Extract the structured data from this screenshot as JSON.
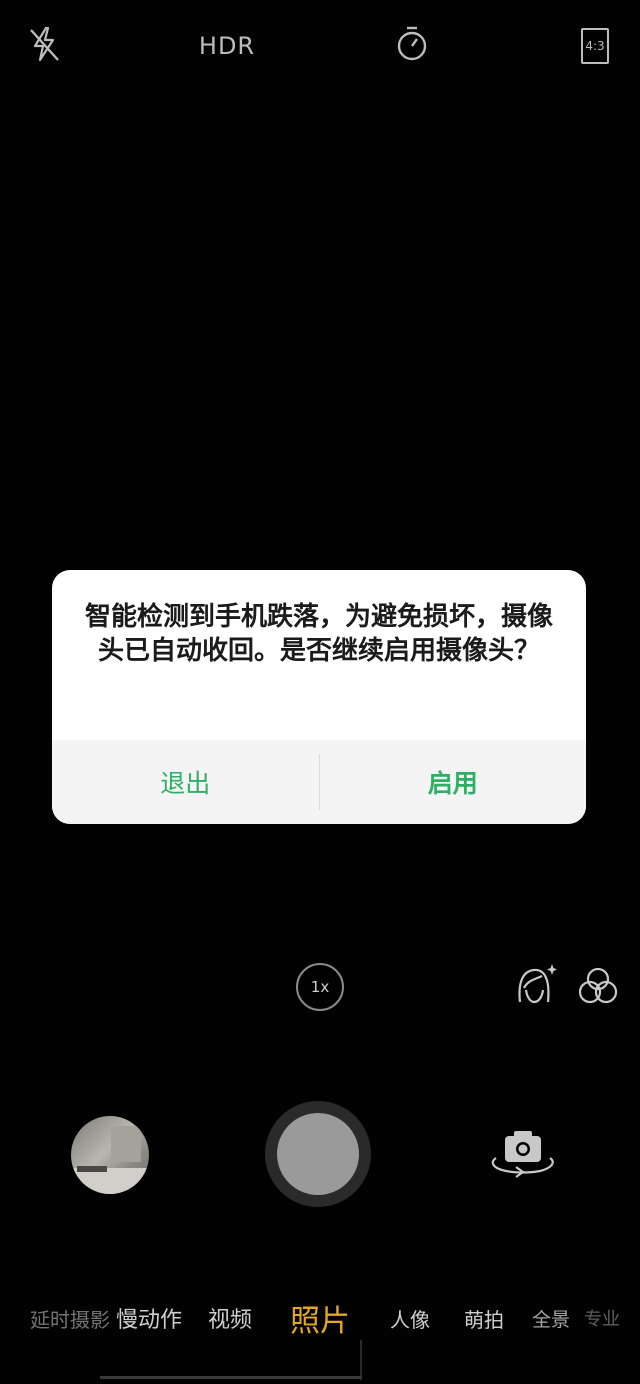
{
  "top_bar": {
    "flash_icon": "flash-off-icon",
    "hdr_label": "HDR",
    "timer_icon": "timer-icon",
    "aspect_ratio": "4:3"
  },
  "dialog": {
    "message": "智能检测到手机跌落，为避免损坏，摄像头已自动收回。是否继续启用摄像头？",
    "exit_label": "退出",
    "enable_label": "启用",
    "accent_color": "#2fae66"
  },
  "controls": {
    "zoom_label": "1x",
    "beauty_icon": "beauty-face-icon",
    "filter_icon": "filter-icon",
    "gallery_icon": "gallery-thumbnail",
    "shutter_icon": "shutter-button",
    "flip_icon": "switch-camera-icon"
  },
  "modes": {
    "items": [
      "延时摄影",
      "慢动作",
      "视频",
      "照片",
      "人像",
      "萌拍",
      "全景",
      "专业"
    ],
    "selected": "照片",
    "selected_color": "#e3a826"
  }
}
